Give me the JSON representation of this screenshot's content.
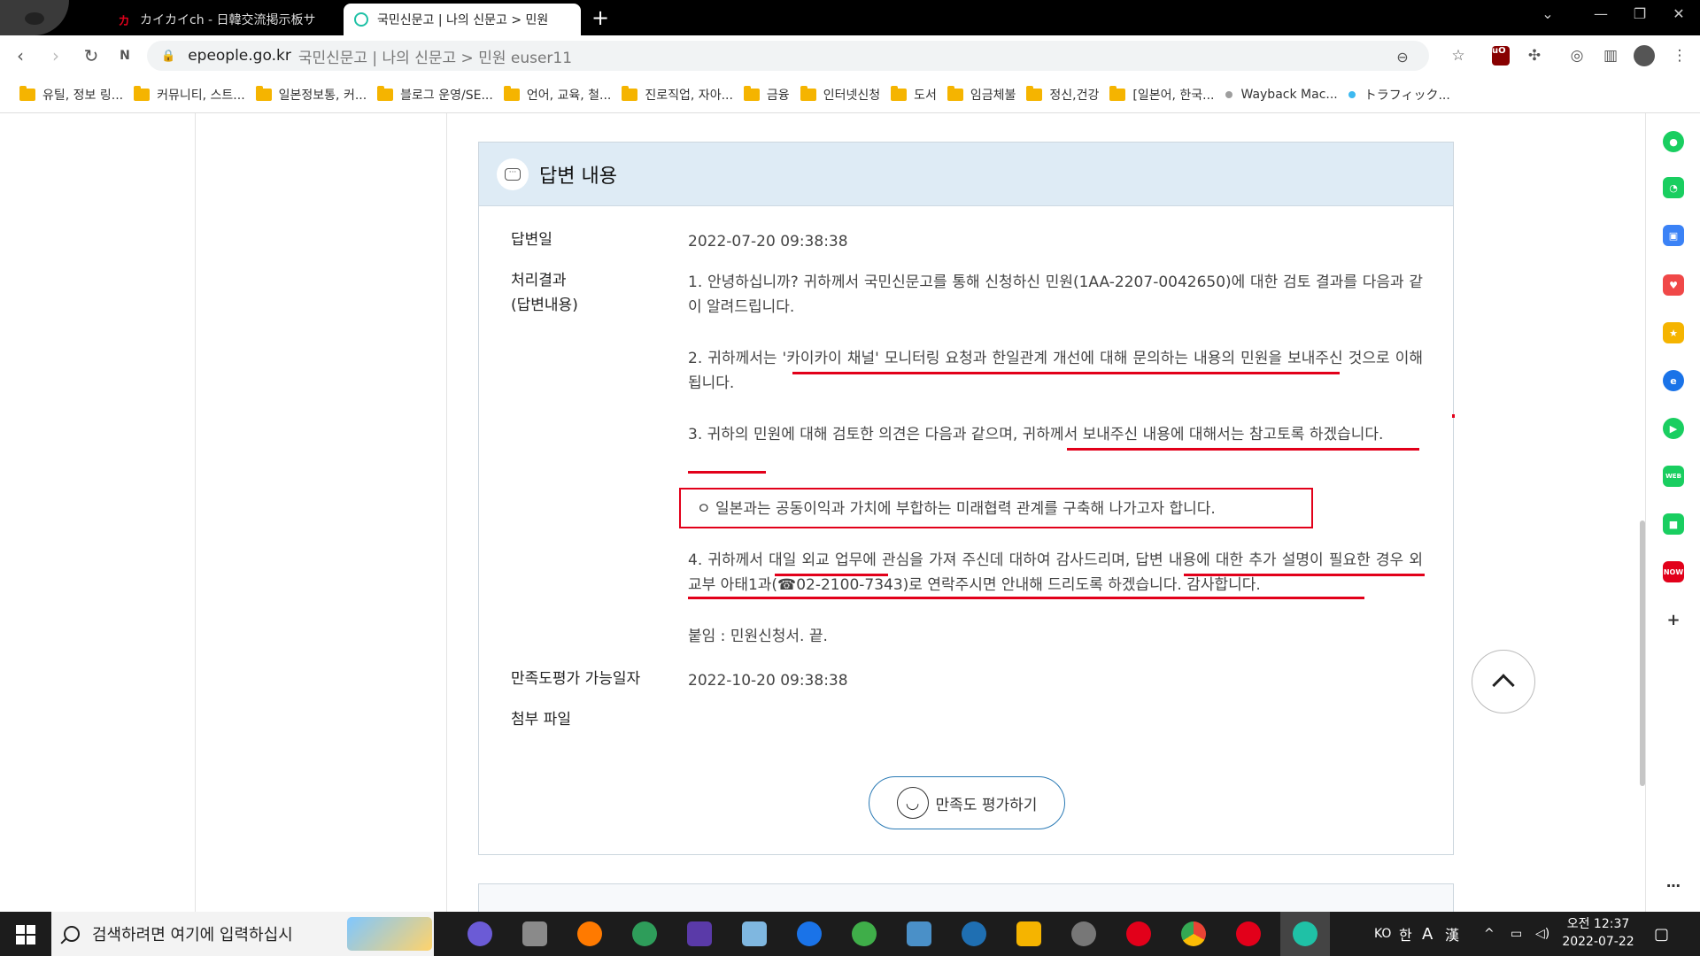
{
  "browser": {
    "tabs": [
      {
        "title": "カイカイch - 日韓交流掲示板サ",
        "active": false
      },
      {
        "title": "국민신문고 | 나의 신문고 > 민원",
        "active": true
      }
    ],
    "address": {
      "domain": "epeople.go.kr",
      "path": "국민신문고 | 나의 신문고 > 민원 euser11"
    },
    "bookmarks": [
      {
        "label": "유틸, 정보 링...",
        "type": "folder"
      },
      {
        "label": "커뮤니티, 스트...",
        "type": "folder"
      },
      {
        "label": "일본정보통, 커...",
        "type": "folder"
      },
      {
        "label": "블로그 운영/SE...",
        "type": "folder"
      },
      {
        "label": "언어, 교육, 철...",
        "type": "folder"
      },
      {
        "label": "진로직업, 자아...",
        "type": "folder"
      },
      {
        "label": "금융",
        "type": "folder"
      },
      {
        "label": "인터넷신청",
        "type": "folder"
      },
      {
        "label": "도서",
        "type": "folder"
      },
      {
        "label": "임금체불",
        "type": "folder"
      },
      {
        "label": "정신,건강",
        "type": "folder"
      },
      {
        "label": "[일본어, 한국...",
        "type": "folder"
      },
      {
        "label": "Wayback Mac...",
        "type": "link",
        "color": "#9e9e9e"
      },
      {
        "label": "トラフィック...",
        "type": "link",
        "color": "#3db9f0"
      }
    ]
  },
  "answer": {
    "section_title": "답변 내용",
    "date_label": "답변일",
    "date_value": "2022-07-20 09:38:38",
    "result_label_1": "처리결과",
    "result_label_2": "(답변내용)",
    "paragraphs": [
      "1. 안녕하십니까? 귀하께서 국민신문고를 통해 신청하신 민원(1AA-2207-0042650)에 대한 검토 결과를 다음과 같이 알려드립니다.",
      "2. 귀하께서는 '카이카이 채널' 모니터링 요청과 한일관계 개선에 대해 문의하는 내용의 민원을 보내주신 것으로 이해됩니다.",
      "3. 귀하의 민원에 대해 검토한 의견은 다음과 같으며, 귀하께서 보내주신 내용에 대해서는 참고토록 하겠습니다.",
      "ㅇ 일본과는 공동이익과 가치에 부합하는 미래협력 관계를 구축해 나가고자 합니다.",
      "4. 귀하께서 대일 외교 업무에 관심을 가져 주신데 대하여 감사드리며, 답변 내용에 대한 추가 설명이 필요한 경우 외교부 아태1과(☎02-2100-7343)로 연락주시면 안내해 드리도록 하겠습니다. 감사합니다.",
      "붙임 : 민원신청서. 끝."
    ],
    "satisfaction_label": "만족도평가 가능일자",
    "satisfaction_value": "2022-10-20 09:38:38",
    "attachment_label": "첨부 파일",
    "rate_button": "만족도 평가하기"
  },
  "taskbar": {
    "search_placeholder": "검색하려면 여기에 입력하십시",
    "ime": [
      "KO",
      "한",
      "A",
      "漢"
    ],
    "time_line1": "오전 12:37",
    "time_line2": "2022-07-22"
  },
  "colors": {
    "accent_red": "#e2001a",
    "card_header": "#deebf5",
    "button_border": "#2a7ab5"
  }
}
